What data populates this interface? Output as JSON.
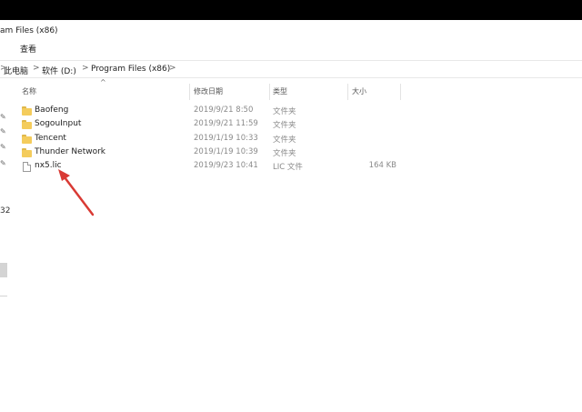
{
  "window": {
    "title": "am Files (x86)"
  },
  "ribbon": {
    "tab_view": "查看"
  },
  "address": {
    "crumb_this_pc": "此电脑",
    "crumb_drive": "软件 (D:)",
    "crumb_folder": "Program Files (x86)",
    "separator": ">"
  },
  "columns": {
    "name": "名称",
    "date": "修改日期",
    "type": "类型",
    "size": "大小"
  },
  "files": [
    {
      "name": "Baofeng",
      "date": "2019/9/21 8:50",
      "type": "文件夹",
      "size": "",
      "icon": "folder-icon"
    },
    {
      "name": "SogouInput",
      "date": "2019/9/21 11:59",
      "type": "文件夹",
      "size": "",
      "icon": "folder-icon"
    },
    {
      "name": "Tencent",
      "date": "2019/1/19 10:33",
      "type": "文件夹",
      "size": "",
      "icon": "folder-icon"
    },
    {
      "name": "Thunder Network",
      "date": "2019/1/19 10:39",
      "type": "文件夹",
      "size": "",
      "icon": "folder-icon"
    },
    {
      "name": "nx5.lic",
      "date": "2019/9/23 10:41",
      "type": "LIC 文件",
      "size": "164 KB",
      "icon": "file-icon"
    }
  ],
  "left_pane": {
    "fragment_text": "32"
  },
  "colors": {
    "folder": "#f4cc5c",
    "annotation_arrow": "#d93a34"
  }
}
